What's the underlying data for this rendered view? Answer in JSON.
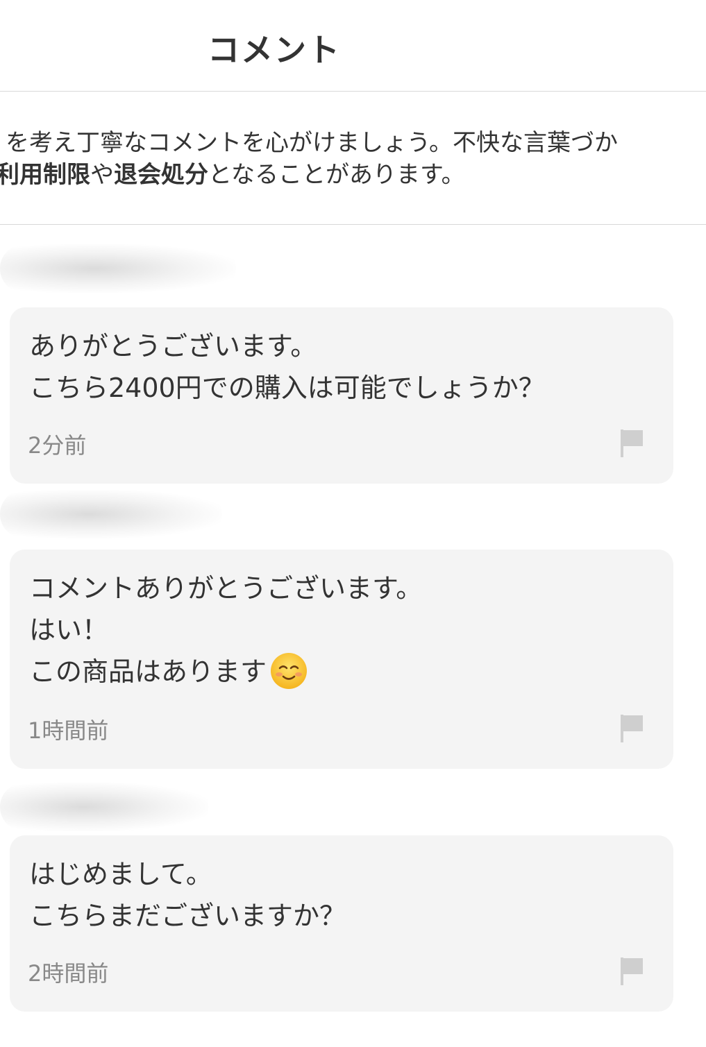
{
  "header": {
    "title": "コメント"
  },
  "notice": {
    "line1": "を考え丁寧なコメントを心がけましょう。不快な言葉づか",
    "line2_start": "利用制限",
    "line2_mid": "や",
    "line2_bold": "退会処分",
    "line2_end": "となることがあります。"
  },
  "comments": [
    {
      "lines": [
        "ありがとうございます。",
        "こちら2400円での購入は可能でしょうか？"
      ],
      "time": "2分前",
      "icon": "flag-icon"
    },
    {
      "lines": [
        "コメントありがとうございます。",
        "はい！",
        "この商品はあります"
      ],
      "emoji": "smiling-face-emoji",
      "time": "1時間前",
      "icon": "flag-icon"
    },
    {
      "lines": [
        "はじめまして。",
        "こちらまだございますか？"
      ],
      "time": "2時間前",
      "icon": "flag-icon"
    }
  ]
}
